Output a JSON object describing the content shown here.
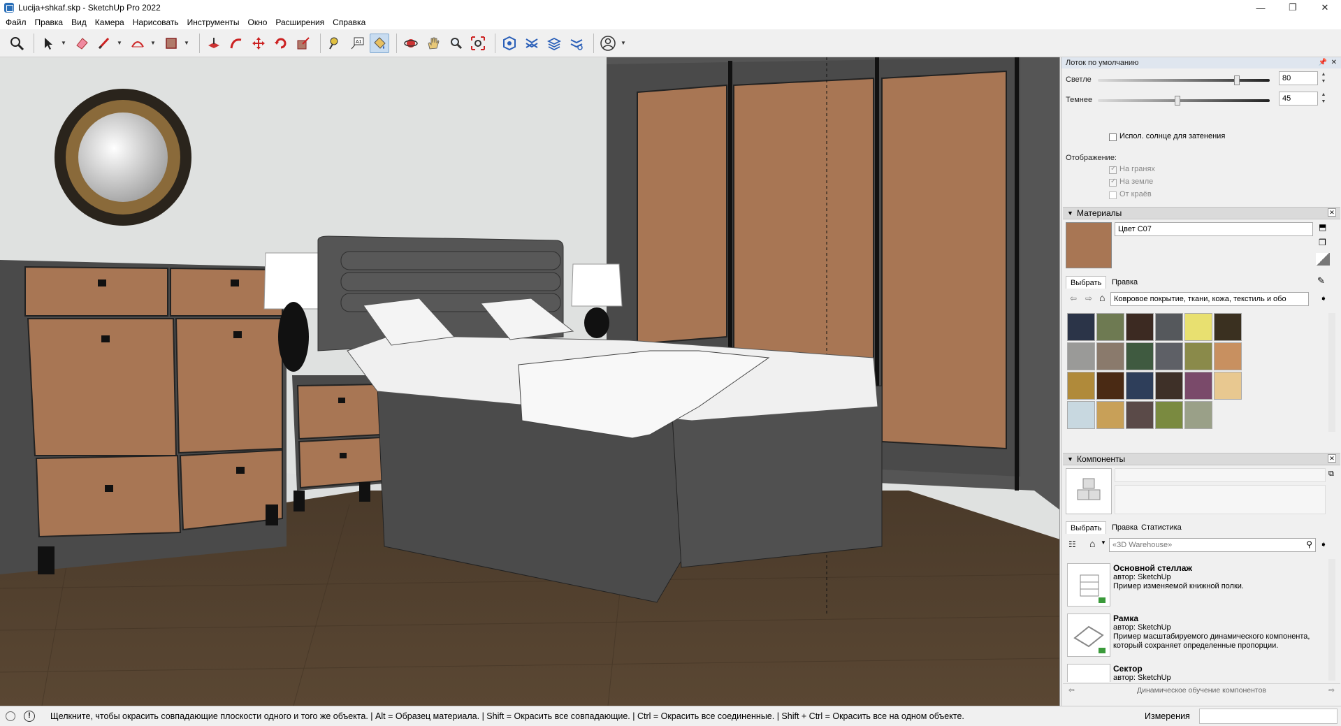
{
  "window": {
    "title": "Lucija+shkaf.skp - SketchUp Pro 2022",
    "minimize": "—",
    "maximize": "❐",
    "close": "✕"
  },
  "menu": [
    "Файл",
    "Правка",
    "Вид",
    "Камера",
    "Нарисовать",
    "Инструменты",
    "Окно",
    "Расширения",
    "Справка"
  ],
  "tray": {
    "title": "Лоток по умолчанию",
    "shadows": {
      "light_label": "Светле",
      "light_value": "80",
      "light_level": 0.8,
      "dark_label": "Темнее",
      "dark_value": "45",
      "dark_level": 0.45,
      "use_sun_label": "Испол. солнце для затенения",
      "display_label": "Отображение:",
      "on_faces": "На гранях",
      "on_ground": "На земле",
      "from_edges": "От краёв"
    },
    "materials": {
      "header": "Материалы",
      "name": "Цвет C07",
      "current_color": "#a87654",
      "tab_select": "Выбрать",
      "tab_edit": "Правка",
      "library": "Ковровое покрытие, ткани, кожа, текстиль и обо"
    },
    "components": {
      "header": "Компоненты",
      "tab_select": "Выбрать",
      "tab_edit": "Правка",
      "tab_stats": "Статистика",
      "search_placeholder": "«3D Warehouse»",
      "items": [
        {
          "title": "Основной стеллаж",
          "author": "автор: SketchUp",
          "desc": "Пример изменяемой книжной полки."
        },
        {
          "title": "Рамка",
          "author": "автор: SketchUp",
          "desc": "Пример масштабируемого динамического компонента, который сохраняет определенные пропорции."
        },
        {
          "title": "Сектор",
          "author": "автор: SketchUp",
          "desc": ""
        }
      ],
      "footer": "Динамическое обучение компонентов"
    }
  },
  "status": {
    "hint": "Щелкните, чтобы окрасить совпадающие плоскости одного и того же объекта. | Alt = Образец материала. | Shift = Окрасить все совпадающие. | Ctrl = Окрасить все соединенные. | Shift + Ctrl = Окрасить все на одном объекте.",
    "measure_label": "Измерения"
  }
}
